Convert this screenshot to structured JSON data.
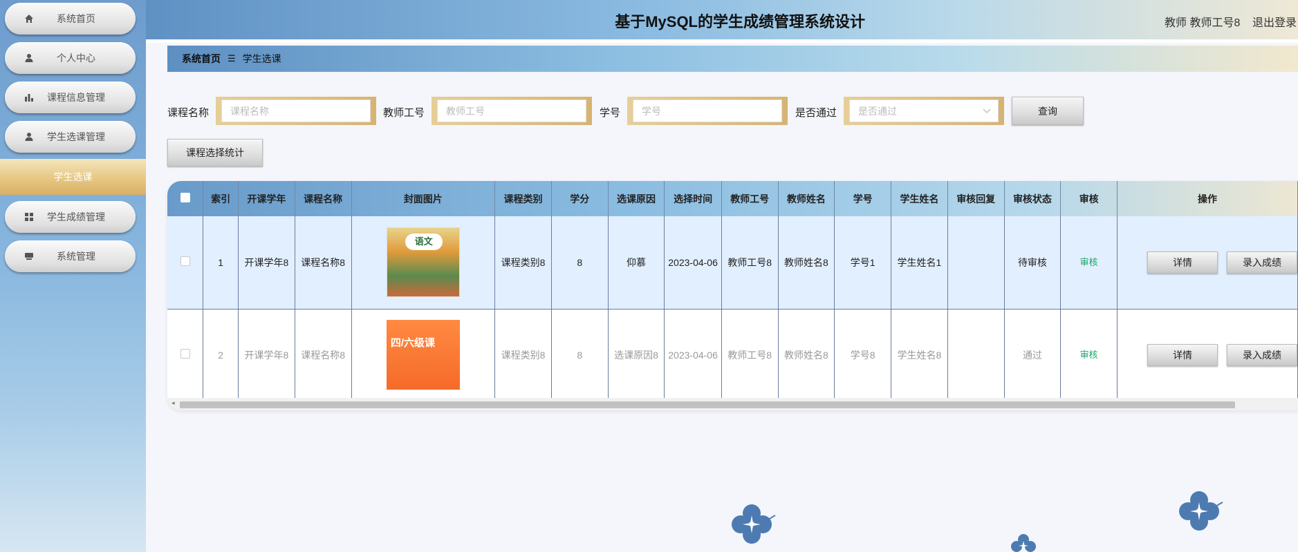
{
  "sidebar": {
    "items": [
      {
        "label": "系统首页",
        "icon": "home-icon"
      },
      {
        "label": "个人中心",
        "icon": "user-icon"
      },
      {
        "label": "课程信息管理",
        "icon": "bar-chart-icon"
      },
      {
        "label": "学生选课管理",
        "icon": "user-icon"
      },
      {
        "label": "学生成绩管理",
        "icon": "grid-icon"
      },
      {
        "label": "系统管理",
        "icon": "monitor-icon"
      }
    ],
    "active_sub": "学生选课"
  },
  "header": {
    "title": "基于MySQL的学生成绩管理系统设计",
    "user": "教师 教师工号8",
    "logout": "退出登录"
  },
  "breadcrumb": {
    "home": "系统首页",
    "separator": "☰",
    "current": "学生选课"
  },
  "search": {
    "course_name_label": "课程名称",
    "course_name_placeholder": "课程名称",
    "teacher_no_label": "教师工号",
    "teacher_no_placeholder": "教师工号",
    "student_no_label": "学号",
    "student_no_placeholder": "学号",
    "passed_label": "是否通过",
    "passed_placeholder": "是否通过",
    "query_button": "查询",
    "stats_button": "课程选择统计"
  },
  "table": {
    "headers": [
      "索引",
      "开课学年",
      "课程名称",
      "封面图片",
      "课程类别",
      "学分",
      "选课原因",
      "选择时间",
      "教师工号",
      "教师姓名",
      "学号",
      "学生姓名",
      "审核回复",
      "审核状态",
      "审核",
      "操作"
    ],
    "rows": [
      {
        "index": "1",
        "year": "开课学年8",
        "course": "课程名称8",
        "category": "课程类别8",
        "credit": "8",
        "reason": "仰慕",
        "time": "2023-04-06",
        "teacher_no": "教师工号8",
        "teacher_name": "教师姓名8",
        "student_no": "学号1",
        "student_name": "学生姓名1",
        "reply": "",
        "status": "待审核",
        "audit": "审核",
        "detail": "详情",
        "enter": "录入成绩",
        "cover_title": "语文"
      },
      {
        "index": "2",
        "year": "开课学年8",
        "course": "课程名称8",
        "category": "课程类别8",
        "credit": "8",
        "reason": "选课原因8",
        "time": "2023-04-06",
        "teacher_no": "教师工号8",
        "teacher_name": "教师姓名8",
        "student_no": "学号8",
        "student_name": "学生姓名8",
        "reply": "",
        "status": "通过",
        "audit": "审核",
        "detail": "详情",
        "enter": "录入成绩",
        "cover_title": "四/六级课"
      }
    ]
  },
  "colors": {
    "accent_blue": "#5f91c4",
    "accent_gold": "#d9b065",
    "audit_green": "#1aa56a",
    "flower_blue": "#4d7bb1"
  }
}
